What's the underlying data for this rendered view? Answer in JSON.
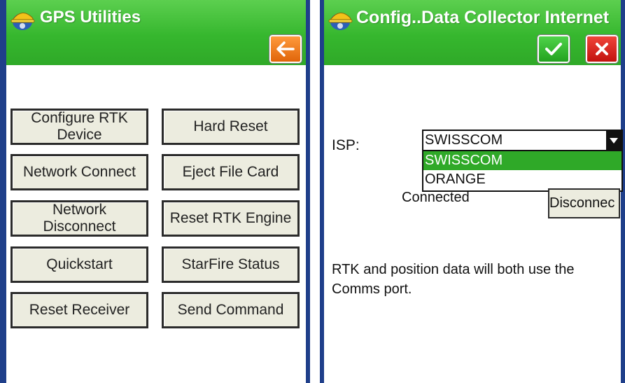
{
  "left": {
    "title": "GPS Utilities",
    "buttons": [
      "Configure RTK Device",
      "Hard Reset",
      "Network Connect",
      "Eject File Card",
      "Network Disconnect",
      "Reset RTK Engine",
      "Quickstart",
      "StarFire Status",
      "Reset Receiver",
      "Send Command"
    ]
  },
  "right": {
    "title": "Config..Data Collector Internet",
    "isp_label": "ISP:",
    "isp_selected": "SWISSCOM",
    "isp_options": [
      "SWISSCOM",
      "ORANGE"
    ],
    "status_text": "Connected",
    "disconnect_label": "Disconnec",
    "info_text": "RTK and position data will both use the Comms port."
  },
  "colors": {
    "titlebar_green": "#36b72e",
    "frame_blue": "#1f3f8a",
    "back_orange": "#e0650a",
    "ok_green": "#23a21f",
    "cancel_red": "#c2120e",
    "selection_green": "#2fa928",
    "button_face": "#ececdf"
  },
  "icons": {
    "app": "helmet-satellite-icon",
    "back": "arrow-left-icon",
    "ok": "checkmark-icon",
    "cancel": "close-x-icon",
    "dropdown": "triangle-down-icon"
  }
}
